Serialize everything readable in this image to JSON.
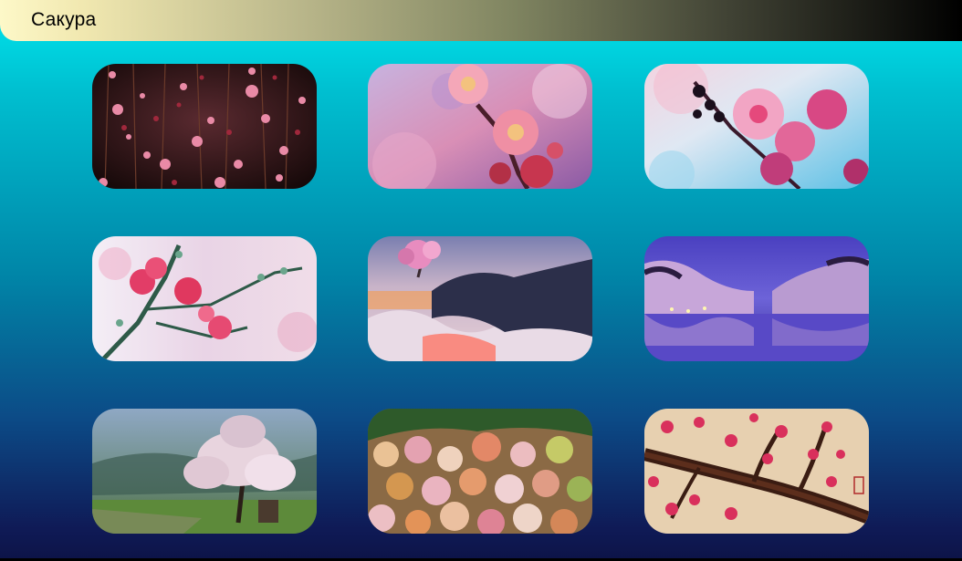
{
  "header": {
    "title": "Сакура"
  },
  "gallery": {
    "items": [
      {
        "name": "hanging-pink-blossoms-dark"
      },
      {
        "name": "pink-blossom-macro"
      },
      {
        "name": "blossom-dark-berries-blue-sky"
      },
      {
        "name": "pink-flowers-on-branch"
      },
      {
        "name": "fantasy-sakura-tree-clouds"
      },
      {
        "name": "sakura-lake-reflection-night"
      },
      {
        "name": "lone-sakura-tree-field"
      },
      {
        "name": "blossoming-hillside-forest"
      },
      {
        "name": "sakura-branch-painting"
      }
    ]
  }
}
